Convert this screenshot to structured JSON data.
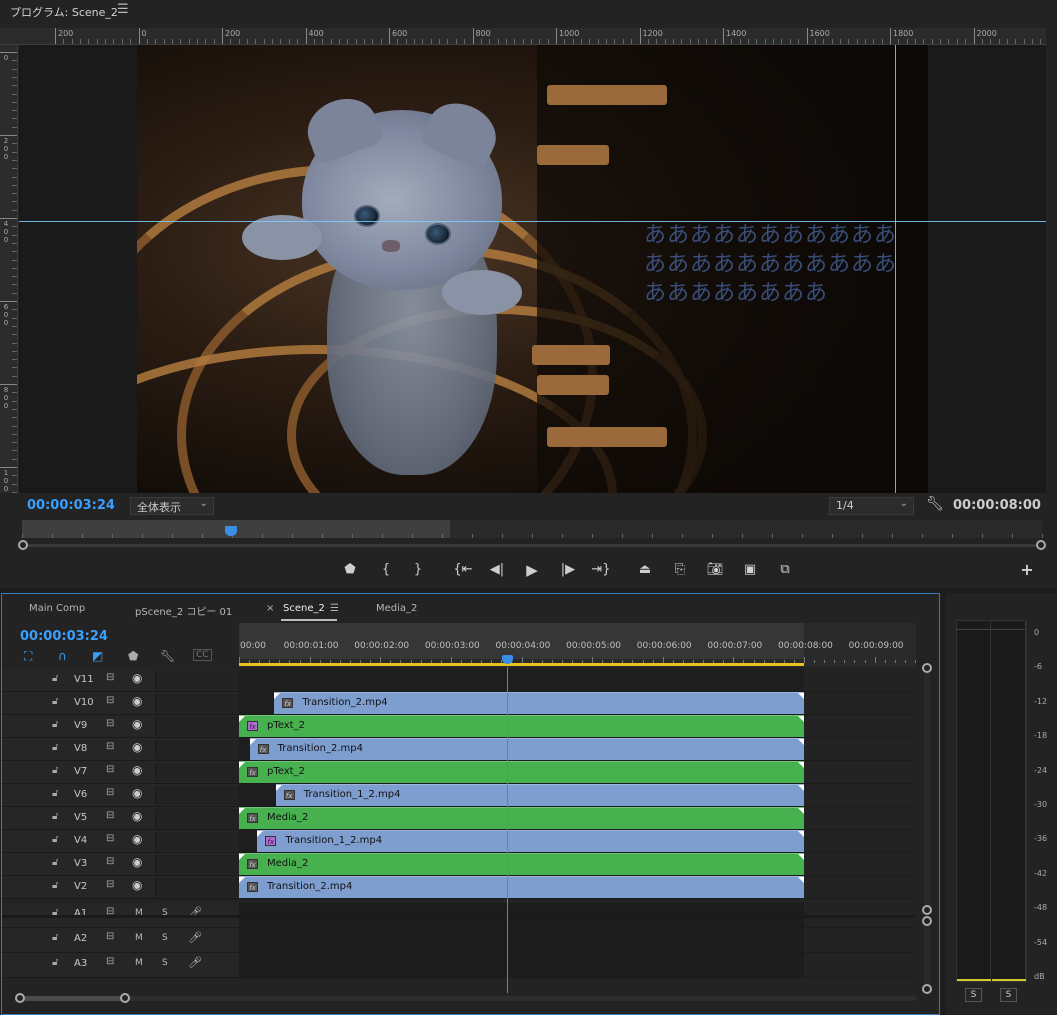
{
  "program_monitor": {
    "title": "プログラム: Scene_2",
    "menu_icon": "hamburger-icon",
    "ruler_h_labels": [
      "200",
      "0",
      "200",
      "400",
      "600",
      "800",
      "1000",
      "1200",
      "1400",
      "1600",
      "1800",
      "2000"
    ],
    "ruler_v_labels": [
      "0",
      "200",
      "400",
      "600",
      "800",
      "1000"
    ],
    "overlay_text": "ああああああああああああああああああああああああああああああ",
    "timecode_current": "00:00:03:24",
    "fit_select": "全体表示",
    "resolution_select": "1/4",
    "timecode_duration": "00:00:08:00",
    "playhead_fraction": 0.475,
    "in_range_fraction": 0.42,
    "transport_icons": [
      "marker-icon",
      "mark-in-icon",
      "mark-out-icon",
      "go-to-in-icon",
      "step-back-icon",
      "play-icon",
      "step-forward-icon",
      "go-to-out-icon",
      "lift-icon",
      "extract-icon",
      "export-frame-icon",
      "comparison-view-icon",
      "toggle-proxy-icon",
      "add-button-icon"
    ]
  },
  "timeline": {
    "tabs": [
      {
        "label": "Main Comp"
      },
      {
        "label": "pScene_2 コピー 01"
      },
      {
        "label": "Scene_2",
        "active": true
      },
      {
        "label": "Media_2"
      }
    ],
    "close_glyph": "×",
    "menu_glyph": "☰",
    "timecode": "00:00:03:24",
    "ruler_labels": [
      "00:00",
      "00:00:01:00",
      "00:00:02:00",
      "00:00:03:00",
      "00:00:04:00",
      "00:00:05:00",
      "00:00:06:00",
      "00:00:07:00",
      "00:00:08:00",
      "00:00:09:00"
    ],
    "playhead_seconds": 3.8,
    "sequence_end_seconds": 8,
    "visible_seconds": 9.6,
    "video_tracks": [
      {
        "name": "V11",
        "clip": null
      },
      {
        "name": "V10",
        "clip": {
          "label": "Transition_2.mp4",
          "color": "blue",
          "start": 0.5,
          "fx": "dark"
        }
      },
      {
        "name": "V9",
        "clip": {
          "label": "pText_2",
          "color": "green",
          "start": 0,
          "fx": "purple"
        }
      },
      {
        "name": "V8",
        "clip": {
          "label": "Transition_2.mp4",
          "color": "blue",
          "start": 0.15,
          "fx": "dark"
        }
      },
      {
        "name": "V7",
        "clip": {
          "label": "pText_2",
          "color": "green",
          "start": 0,
          "fx": "dark"
        }
      },
      {
        "name": "V6",
        "clip": {
          "label": "Transition_1_2.mp4",
          "color": "blue",
          "start": 0.52,
          "fx": "dark"
        }
      },
      {
        "name": "V5",
        "clip": {
          "label": "Media_2",
          "color": "green",
          "start": 0,
          "fx": "dark"
        }
      },
      {
        "name": "V4",
        "clip": {
          "label": "Transition_1_2.mp4",
          "color": "blue",
          "start": 0.26,
          "fx": "purple"
        }
      },
      {
        "name": "V3",
        "clip": {
          "label": "Media_2",
          "color": "green",
          "start": 0,
          "fx": "dark"
        }
      },
      {
        "name": "V2",
        "clip": {
          "label": "Transition_2.mp4",
          "color": "blue",
          "start": 0,
          "fx": "dark"
        }
      }
    ],
    "audio_tracks": [
      {
        "name": "A1",
        "m": "M",
        "s": "S"
      },
      {
        "name": "A2",
        "m": "M",
        "s": "S"
      },
      {
        "name": "A3",
        "m": "M",
        "s": "S"
      }
    ],
    "colors": {
      "blue_clip": "#7f9ed0",
      "green_clip": "#47b14f",
      "playhead": "#3a8ee6",
      "work_area": "#e6c21f"
    }
  },
  "audio_meter": {
    "db_labels": [
      "0",
      "-6",
      "-12",
      "-18",
      "-24",
      "-30",
      "-36",
      "-42",
      "-48",
      "-54",
      "dB"
    ],
    "solo_left": "S",
    "solo_right": "S"
  }
}
